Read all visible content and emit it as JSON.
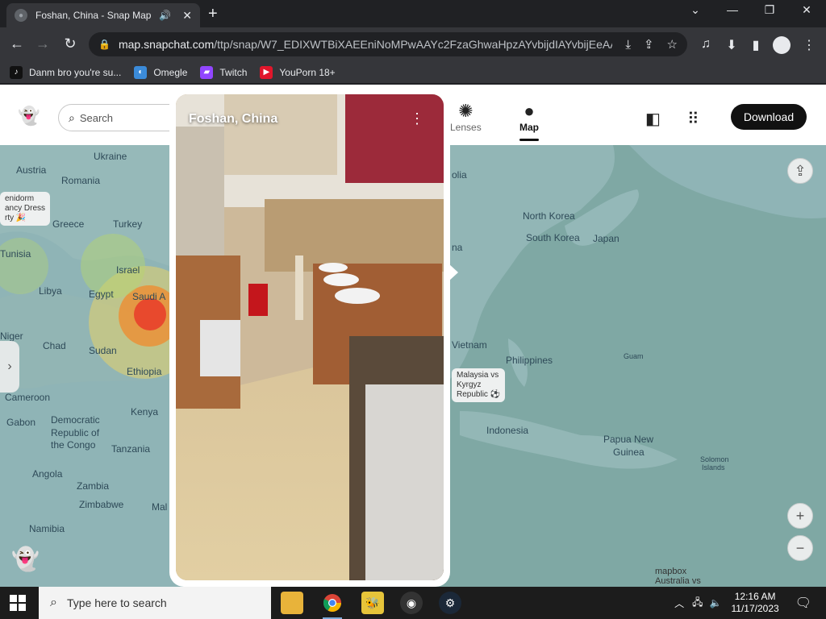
{
  "browser": {
    "tab_title": "Foshan, China - Snap Map",
    "url_host": "map.snapchat.com",
    "url_path": "/ttp/snap/W7_EDIXWTBiXAEEniNoMPwAAYc2FzaGhwaHpzAYvbijdIAYvbijEeAA...",
    "bookmarks": [
      {
        "label": "Danm bro you're su...",
        "icon": "tiktok-icon",
        "color": "#111111"
      },
      {
        "label": "Omegle",
        "icon": "omegle-icon",
        "color": "#3b8bd9"
      },
      {
        "label": "Twitch",
        "icon": "twitch-icon",
        "color": "#9146ff"
      },
      {
        "label": "YouPorn 18+",
        "icon": "youporn-icon",
        "color": "#e0162b"
      }
    ]
  },
  "header": {
    "search_placeholder": "Search",
    "nav": [
      {
        "label": "Lenses",
        "icon": "lenses-icon"
      },
      {
        "label": "Map",
        "icon": "map-pin-icon",
        "active": true
      }
    ],
    "download_label": "Download"
  },
  "map": {
    "labels": [
      "Ukraine",
      "Austria",
      "Romania",
      "Greece",
      "Turkey",
      "Tunisia",
      "Israel",
      "Libya",
      "Egypt",
      "Saudi A",
      "Niger",
      "Chad",
      "Sudan",
      "Ethiopia",
      "Cameroon",
      "Gabon",
      "Democratic",
      "Republic of",
      "the Congo",
      "Kenya",
      "Tanzania",
      "Angola",
      "Zambia",
      "Zimbabwe",
      "Mal",
      "Namibia",
      "olia",
      "North Korea",
      "South Korea",
      "Japan",
      "na",
      "Vietnam",
      "Philippines",
      "Guam",
      "Indonesia",
      "Papua New",
      "Guinea",
      "Solomon",
      "Islands"
    ],
    "callouts": [
      {
        "text": "enidorm\nancy Dress\nrty 🎉"
      },
      {
        "text": "Malaysia vs\nKyrgyz\nRepublic ⚽"
      }
    ],
    "attribution": "mapbox",
    "bottom_callout": "Australia vs"
  },
  "story": {
    "location": "Foshan, China"
  },
  "taskbar": {
    "search_placeholder": "Type here to search",
    "time": "12:16 AM",
    "date": "11/17/2023"
  },
  "colors": {
    "ocean": "#7fa8a4",
    "land": "#8fb4b6",
    "heat": "#e8402b"
  }
}
